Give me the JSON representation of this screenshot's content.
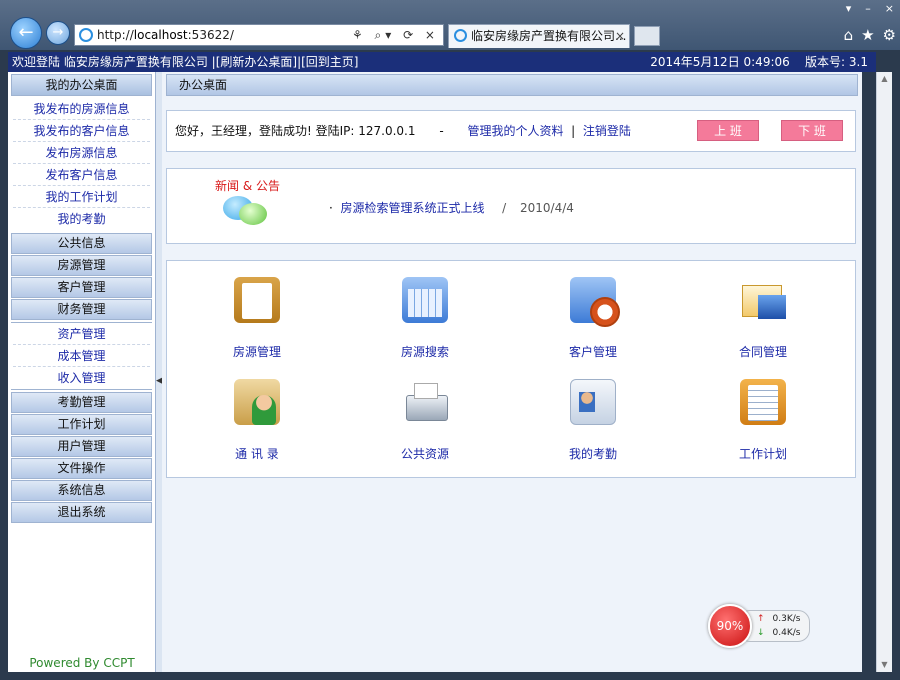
{
  "browser": {
    "address_prefix": "http://",
    "address_host": "localhost",
    "address_rest": ":53622/",
    "tab_title": "临安房缘房产置换有限公司...",
    "tab_close": "×",
    "win_minimize": "▾",
    "win_down": "–",
    "win_close": "×",
    "address_tools": "⚘ ⌕▾ ⟳ ×"
  },
  "topbar": {
    "welcome": "欢迎登陆 临安房缘房产置换有限公司",
    "links": "|[刷新办公桌面]|[回到主页]",
    "datetime": "2014年5月12日 0:49:06",
    "version_label": "版本号: 3.1"
  },
  "sidebar": {
    "header": "我的办公桌面",
    "desk_items": [
      "我发布的房源信息",
      "我发布的客户信息",
      "发布房源信息",
      "发布客户信息",
      "我的工作计划",
      "我的考勤"
    ],
    "groups_a": [
      "公共信息",
      "房源管理",
      "客户管理",
      "财务管理"
    ],
    "finance_items": [
      "资产管理",
      "成本管理",
      "收入管理"
    ],
    "groups_b": [
      "考勤管理",
      "工作计划",
      "用户管理",
      "文件操作",
      "系统信息",
      "退出系统"
    ],
    "powered": "Powered By CCPT"
  },
  "main": {
    "crumb": "办公桌面",
    "welcome_text": "您好，王经理，登陆成功! 登陆IP: 127.0.0.1",
    "dash": "-",
    "manage_profile": "管理我的个人资料",
    "logout": "注销登陆",
    "pipe": "|",
    "clock_in": "上  班",
    "clock_out": "下  班",
    "news_title": "新闻 & 公告",
    "news_item": "房源检索管理系统正式上线",
    "news_sep": "/",
    "news_date": "2010/4/4",
    "news_bullet": "·",
    "apps": [
      "房源管理",
      "房源搜索",
      "客户管理",
      "合同管理",
      "通 讯 录",
      "公共资源",
      "我的考勤",
      "工作计划"
    ]
  },
  "speed": {
    "percent": "90%",
    "up": "0.3K/s",
    "down": "0.4K/s",
    "up_arrow": "↑",
    "down_arrow": "↓"
  }
}
